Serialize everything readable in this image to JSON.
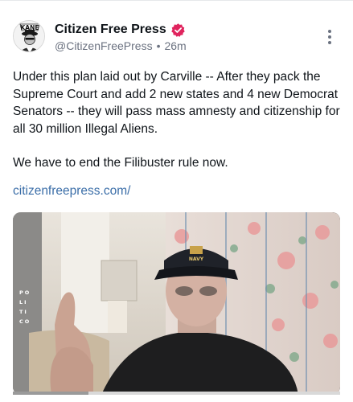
{
  "post": {
    "author": {
      "display_name": "Citizen Free Press",
      "handle": "@CitizenFreePress",
      "time_ago": "26m",
      "avatar_text": "KANE",
      "verified_badge_color": "#e0245e"
    },
    "body": {
      "paragraph_1": "Under this plan laid out by Carville -- After they pack the Supreme Court and add 2 new states and 4 new Democrat Senators -- they will pass mass amnesty and citizenship for all 30 million Illegal Aliens.",
      "paragraph_2": "We have to end the Filibuster rule now."
    },
    "link_text": "citizenfreepress.com/",
    "more_menu_icon": "more-vertical-icon"
  },
  "video": {
    "watermark": [
      "PO",
      "LI",
      "TI",
      "CO"
    ],
    "cap_text": "NAVY",
    "progress": 0.23
  },
  "colors": {
    "link": "#3b6ea8",
    "muted": "#6b7280",
    "text": "#0f1419"
  }
}
